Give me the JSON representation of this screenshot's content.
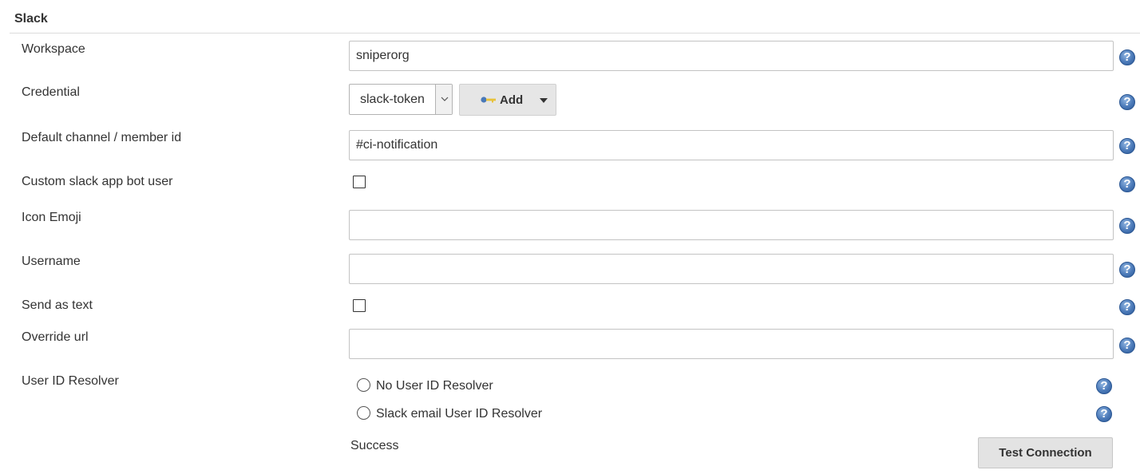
{
  "section": {
    "title": "Slack"
  },
  "fields": {
    "workspace": {
      "label": "Workspace",
      "value": "sniperorg"
    },
    "credential": {
      "label": "Credential",
      "selected": "slack-token",
      "add_label": "Add"
    },
    "default_channel": {
      "label": "Default channel / member id",
      "value": "#ci-notification"
    },
    "custom_bot_user": {
      "label": "Custom slack app bot user",
      "checked": false
    },
    "icon_emoji": {
      "label": "Icon Emoji",
      "value": ""
    },
    "username": {
      "label": "Username",
      "value": ""
    },
    "send_as_text": {
      "label": "Send as text",
      "checked": false
    },
    "override_url": {
      "label": "Override url",
      "value": ""
    },
    "user_id_resolver": {
      "label": "User ID Resolver",
      "options": [
        "No User ID Resolver",
        "Slack email User ID Resolver"
      ]
    }
  },
  "help": {
    "glyph": "?"
  },
  "status": {
    "text": "Success"
  },
  "actions": {
    "test_connection": "Test Connection"
  },
  "colors": {
    "help_icon": "#4a79b8",
    "button_bg": "#e3e3e3",
    "border": "#c3c3c3"
  },
  "icons": {
    "help": "help-icon",
    "key": "key-icon",
    "dropdown": "chevron-down-icon",
    "caret": "caret-down-icon"
  }
}
